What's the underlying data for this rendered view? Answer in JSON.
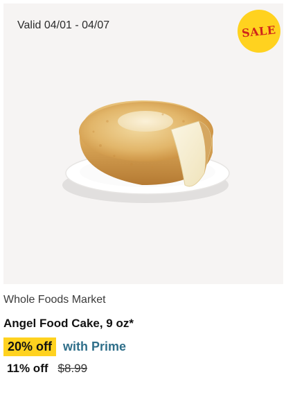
{
  "product_card": {
    "validity": "Valid 04/01 - 04/07",
    "sale_badge": "SALE",
    "image_icon": "angel-food-cake-icon",
    "store": "Whole Foods Market",
    "title": "Angel Food Cake, 9 oz*",
    "deal": {
      "discount": "20% off",
      "prime_label": "with Prime"
    },
    "regular": {
      "discount": "11% off",
      "original_price": "$8.99"
    }
  },
  "colors": {
    "badge_yellow": "#ffd21f",
    "sale_red": "#d0251b",
    "prime_blue": "#2f6f8a",
    "image_bg": "#f6f4f3"
  }
}
